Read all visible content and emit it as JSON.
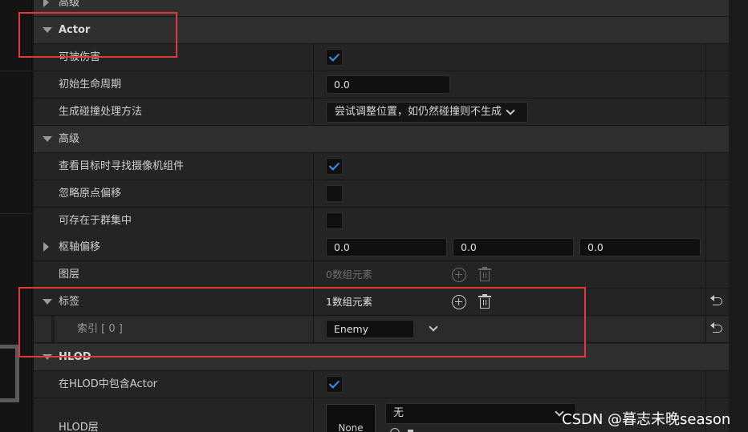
{
  "rows": {
    "advanced_top": "高级",
    "actor": "Actor",
    "can_be_damaged": "可被伤害",
    "initial_life_span": "初始生命周期",
    "initial_life_span_value": "0.0",
    "spawn_collision": "生成碰撞处理方法",
    "spawn_collision_value": "尝试调整位置，如仍然碰撞则不生成",
    "advanced": "高级",
    "find_camera": "查看目标时寻找摄像机组件",
    "ignore_origin_shift": "忽略原点偏移",
    "can_exist_in_cluster": "可存在于群集中",
    "pivot_offset": "枢轴偏移",
    "pivot_x": "0.0",
    "pivot_y": "0.0",
    "pivot_z": "0.0",
    "layers": "图层",
    "layers_count": "0数组元素",
    "tags": "标签",
    "tags_count": "1数组元素",
    "tag_index": "索引 [ 0 ]",
    "tag_value": "Enemy",
    "hlod": "HLOD",
    "include_in_hlod": "在HLOD中包含Actor",
    "hlod_layer": "HLOD层",
    "hlod_none": "None",
    "hlod_layer_value": "无"
  },
  "checks": {
    "can_be_damaged": true,
    "find_camera": true,
    "ignore_origin_shift": false,
    "can_exist_in_cluster": false,
    "include_in_hlod": true
  },
  "icons": [
    "triangle-right-icon",
    "triangle-down-icon",
    "checkmark-icon",
    "chevron-down-icon",
    "plus-circle-icon",
    "trash-icon",
    "reset-arrow-icon"
  ],
  "colors": {
    "accent": "#3b8fe8",
    "highlight": "#e53935"
  },
  "watermark": "CSDN @暮志未晚season"
}
